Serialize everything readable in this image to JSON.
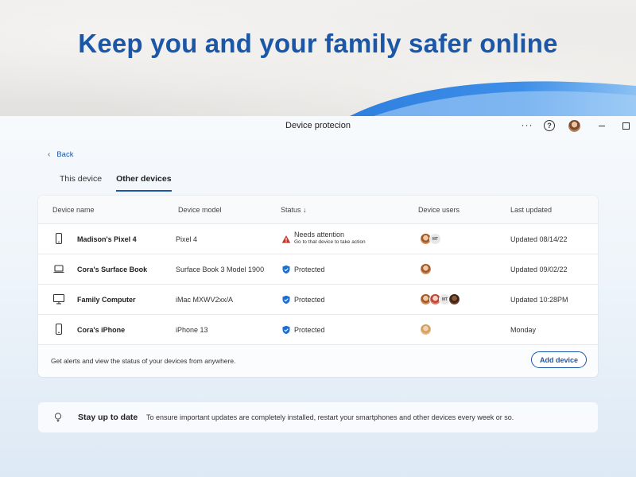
{
  "hero": {
    "title": "Keep you and your family safer online"
  },
  "window": {
    "title": "Device protecion",
    "more_label": "···",
    "help_label": "?"
  },
  "nav": {
    "back_label": "Back",
    "back_chevron": "‹"
  },
  "tabs": [
    {
      "label": "This device",
      "active": false
    },
    {
      "label": "Other devices",
      "active": true
    }
  ],
  "table": {
    "headers": {
      "device_name": "Device name",
      "device_model": "Device model",
      "status": "Status ↓",
      "device_users": "Device users",
      "last_updated": "Last updated"
    },
    "rows": [
      {
        "icon": "phone-icon",
        "name": "Madison's Pixel 4",
        "model": "Pixel 4",
        "status": "Needs attention",
        "status_sub": "Go to that device to take action",
        "status_icon": "warning-icon",
        "users_initials": "MT",
        "updated": "Updated 08/14/22"
      },
      {
        "icon": "laptop-icon",
        "name": "Cora's Surface Book",
        "model": "Surface Book 3 Model 1900",
        "status": "Protected",
        "status_icon": "shield-check-icon",
        "updated": "Updated 09/02/22"
      },
      {
        "icon": "desktop-icon",
        "name": "Family Computer",
        "model": "iMac MXWV2xx/A",
        "status": "Protected",
        "status_icon": "shield-check-icon",
        "users_initials": "MT",
        "updated": "Updated 10:28PM"
      },
      {
        "icon": "phone-icon",
        "name": "Cora's iPhone",
        "model": "iPhone 13",
        "status": "Protected",
        "status_icon": "shield-check-icon",
        "updated": "Monday"
      }
    ],
    "footer_text": "Get alerts and view the status of your devices from anywhere.",
    "add_button": "Add device"
  },
  "tip": {
    "icon": "lightbulb-icon",
    "title": "Stay up to date",
    "text": "To ensure important updates are completely installed, restart your smartphones and other devices every week or so."
  },
  "colors": {
    "accent": "#1b57a6",
    "warning": "#c0392b",
    "protected": "#1b6fd1"
  }
}
